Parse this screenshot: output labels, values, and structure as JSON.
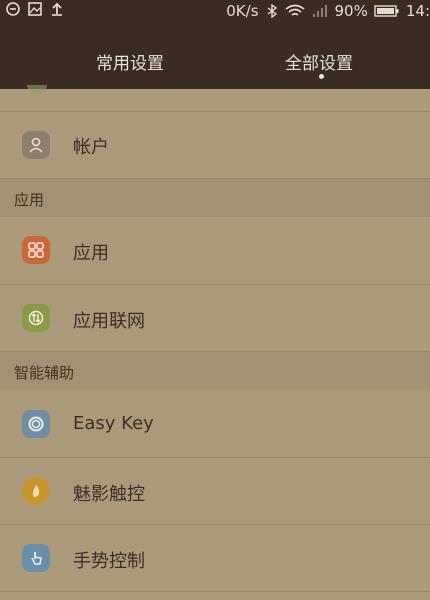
{
  "status_bar": {
    "speed": "0K/s",
    "battery": "90%",
    "time": "14:",
    "icons": [
      "message-icon",
      "image-icon",
      "upload-icon",
      "bluetooth-icon",
      "wifi-icon",
      "signal-icon",
      "battery-icon"
    ]
  },
  "tabs": [
    {
      "label": "常用设置",
      "active": false
    },
    {
      "label": "全部设置",
      "active": true
    }
  ],
  "sections": [
    {
      "type": "item",
      "label": "帐户",
      "icon": "account-icon",
      "color": "#8c7f6e"
    },
    {
      "type": "header",
      "label": "应用"
    },
    {
      "type": "item",
      "label": "应用",
      "icon": "apps-icon",
      "color": "#c9683a"
    },
    {
      "type": "item",
      "label": "应用联网",
      "icon": "app-network-icon",
      "color": "#8a9a48"
    },
    {
      "type": "header",
      "label": "智能辅助"
    },
    {
      "type": "item",
      "label": "Easy Key",
      "icon": "easy-key-icon",
      "color": "#6d8fa0"
    },
    {
      "type": "item",
      "label": "魅影触控",
      "icon": "touch-icon",
      "color": "#c8952c"
    },
    {
      "type": "item",
      "label": "手势控制",
      "icon": "gesture-icon",
      "color": "#6b8fa8"
    }
  ]
}
